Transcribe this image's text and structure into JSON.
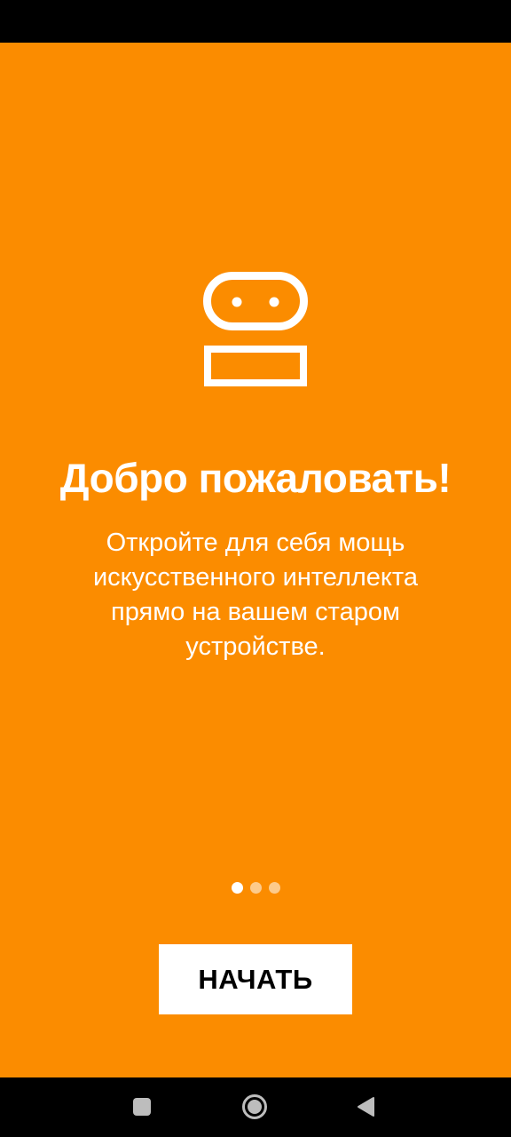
{
  "colors": {
    "background": "#FB8C00",
    "foreground": "#FFFFFF",
    "button_background": "#FFFFFF",
    "button_text": "#000000",
    "system_bars": "#000000"
  },
  "onboarding": {
    "icon": "robot-icon",
    "title": "Добро пожаловать!",
    "description": "Откройте для себя мощь искусственного интеллекта прямо на вашем старом устройстве.",
    "pager": {
      "total_pages": 3,
      "current_page": 1
    },
    "start_button_label": "НАЧАТЬ"
  },
  "navigation_bar": {
    "buttons": [
      "recents-icon",
      "home-icon",
      "back-icon"
    ]
  }
}
